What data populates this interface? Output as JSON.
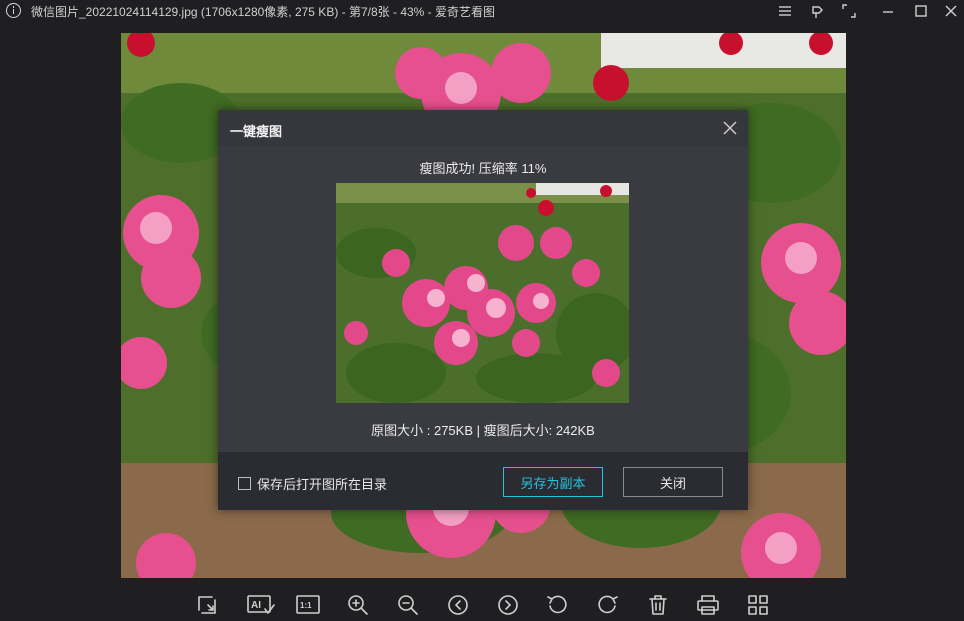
{
  "window": {
    "title": "微信图片_20221024114129.jpg (1706x1280像素, 275 KB) - 第7/8张 - 43% - 爱奇艺看图",
    "controls": [
      "menu-icon",
      "pin-icon",
      "fullscreen-icon",
      "minimize-icon",
      "maximize-icon",
      "close-icon"
    ]
  },
  "dialog": {
    "title": "一键瘦图",
    "success_message": "瘦图成功! 压缩率 11%",
    "compression_rate_percent": 11,
    "size_info": "原图大小 : 275KB | 瘦图后大小: 242KB",
    "original_size_kb": 275,
    "compressed_size_kb": 242,
    "checkbox_label": "保存后打开图所在目录",
    "checkbox_checked": false,
    "save_copy_label": "另存为副本",
    "close_label": "关闭",
    "accent_color": "#22c3dc"
  },
  "toolbar": {
    "ai_label": "AI",
    "actual_size_label": "1:1",
    "items": [
      "crop-icon",
      "ai-enhance-icon",
      "actual-size-icon",
      "zoom-in-icon",
      "zoom-out-icon",
      "previous-icon",
      "next-icon",
      "rotate-left-icon",
      "rotate-right-icon",
      "delete-icon",
      "print-icon",
      "grid-view-icon"
    ]
  }
}
